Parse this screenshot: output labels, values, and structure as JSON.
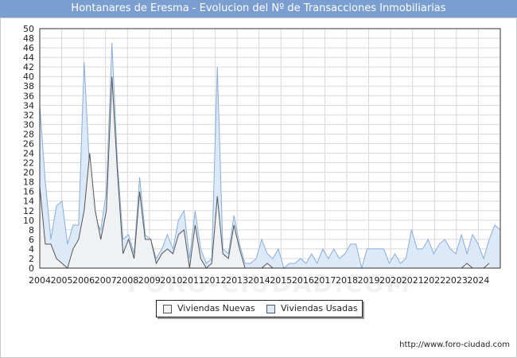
{
  "title": "Hontanares de Eresma - Evolucion del Nº de Transacciones Inmobiliarias",
  "source": "http://www.foro-ciudad.com",
  "watermark": "FORO-CIUDAD.COM",
  "colors": {
    "title_bg": "#7a9ed0",
    "nuevas_fill": "#f2f2f2",
    "nuevas_line": "#555555",
    "usadas_fill": "#dbe9f9",
    "usadas_line": "#8aaed8",
    "grid": "#d8d8d8"
  },
  "chart_data": {
    "type": "area",
    "title": "Hontanares de Eresma - Evolucion del Nº de Transacciones Inmobiliarias",
    "xlabel": "",
    "ylabel": "",
    "x_start": "2004 T1",
    "x_end": "2024 T4",
    "x_ticks": [
      "2004",
      "2005",
      "2006",
      "2007",
      "2008",
      "2009",
      "2010",
      "2011",
      "2012",
      "2013",
      "2014",
      "2015",
      "2016",
      "2017",
      "2018",
      "2019",
      "2020",
      "2021",
      "2022",
      "2023",
      "2024"
    ],
    "ylim": [
      0,
      50
    ],
    "y_ticks": [
      0,
      2,
      4,
      6,
      8,
      10,
      12,
      14,
      16,
      18,
      20,
      22,
      24,
      26,
      28,
      30,
      32,
      34,
      36,
      38,
      40,
      42,
      44,
      46,
      48,
      50
    ],
    "grid": true,
    "legend_position": "bottom",
    "series": [
      {
        "name": "Viviendas Nuevas",
        "values": [
          17,
          5,
          5,
          2,
          1,
          0,
          4,
          6,
          12,
          24,
          12,
          6,
          12,
          40,
          20,
          3,
          6,
          2,
          16,
          6,
          6,
          1,
          3,
          4,
          3,
          7,
          8,
          0,
          9,
          2,
          0,
          1,
          15,
          3,
          2,
          9,
          4,
          0,
          0,
          0,
          0,
          1,
          0,
          0,
          0,
          0,
          0,
          0,
          0,
          0,
          0,
          0,
          0,
          0,
          0,
          0,
          0,
          0,
          0,
          0,
          0,
          0,
          0,
          0,
          0,
          0,
          0,
          0,
          0,
          0,
          0,
          0,
          0,
          0,
          0,
          0,
          0,
          1,
          0,
          0,
          0,
          1
        ]
      },
      {
        "name": "Viviendas Usadas",
        "values": [
          34,
          18,
          6,
          13,
          14,
          5,
          9,
          9,
          43,
          20,
          10,
          8,
          16,
          47,
          22,
          6,
          7,
          3,
          19,
          7,
          6,
          2,
          4,
          7,
          4,
          10,
          12,
          2,
          12,
          4,
          1,
          2,
          42,
          4,
          3,
          11,
          5,
          1,
          1,
          2,
          6,
          3,
          2,
          4,
          0,
          1,
          1,
          2,
          1,
          3,
          1,
          4,
          2,
          4,
          2,
          3,
          5,
          5,
          0,
          4,
          4,
          4,
          4,
          1,
          3,
          1,
          2,
          8,
          4,
          4,
          6,
          3,
          5,
          6,
          4,
          3,
          7,
          3,
          7,
          5,
          2,
          6,
          9,
          8
        ]
      }
    ]
  },
  "legend": {
    "nuevas_label": "Viviendas Nuevas",
    "usadas_label": "Viviendas Usadas"
  }
}
